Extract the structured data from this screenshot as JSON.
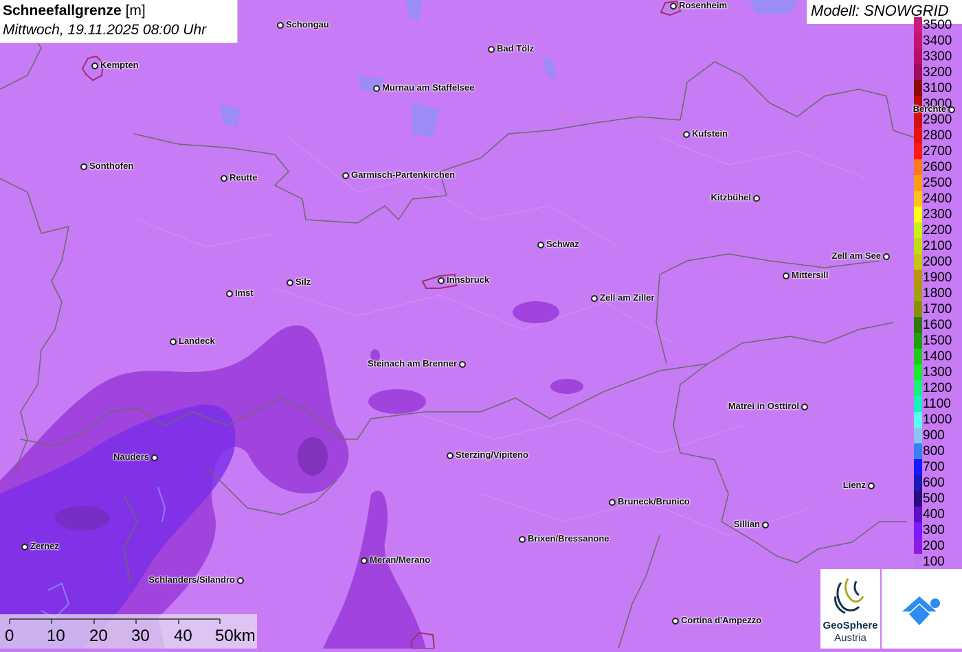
{
  "header": {
    "title": "Schneefallgrenze",
    "unit": "[m]",
    "datetime": "Mittwoch, 19.11.2025 08:00 Uhr"
  },
  "model": {
    "label": "Modell: SNOWGRID"
  },
  "legend": {
    "items": [
      {
        "value": "3500",
        "color": "#cc1a7a"
      },
      {
        "value": "3400",
        "color": "#c21572"
      },
      {
        "value": "3300",
        "color": "#b3106a"
      },
      {
        "value": "3200",
        "color": "#a10a5e"
      },
      {
        "value": "3100",
        "color": "#8e0a0a"
      },
      {
        "value": "3000",
        "color": "#b80c0c"
      },
      {
        "value": "2900",
        "color": "#d40f0f"
      },
      {
        "value": "2800",
        "color": "#e81313"
      },
      {
        "value": "2700",
        "color": "#ff1a1a"
      },
      {
        "value": "2600",
        "color": "#ff7a1a"
      },
      {
        "value": "2500",
        "color": "#ff9d1a"
      },
      {
        "value": "2400",
        "color": "#ffc21a"
      },
      {
        "value": "2300",
        "color": "#ffff1a"
      },
      {
        "value": "2200",
        "color": "#c8f01a"
      },
      {
        "value": "2100",
        "color": "#c0dc14"
      },
      {
        "value": "2000",
        "color": "#c8c314"
      },
      {
        "value": "1900",
        "color": "#b8960f"
      },
      {
        "value": "1800",
        "color": "#a3a00f"
      },
      {
        "value": "1700",
        "color": "#8a8f0a"
      },
      {
        "value": "1600",
        "color": "#2e7a10"
      },
      {
        "value": "1500",
        "color": "#1ea010"
      },
      {
        "value": "1400",
        "color": "#1ecb1a"
      },
      {
        "value": "1300",
        "color": "#1aea30"
      },
      {
        "value": "1200",
        "color": "#1af080"
      },
      {
        "value": "1100",
        "color": "#1af0c0"
      },
      {
        "value": "1000",
        "color": "#5cfff0"
      },
      {
        "value": "900",
        "color": "#8ec4f5"
      },
      {
        "value": "800",
        "color": "#3a80f0"
      },
      {
        "value": "700",
        "color": "#1a1aff"
      },
      {
        "value": "600",
        "color": "#1a1ab8"
      },
      {
        "value": "500",
        "color": "#2a0a80"
      },
      {
        "value": "400",
        "color": "#5c10c8"
      },
      {
        "value": "300",
        "color": "#7a1aff"
      },
      {
        "value": "200",
        "color": "#8e1ae6"
      },
      {
        "value": "100",
        "color": "#c07af0"
      }
    ]
  },
  "cities": [
    {
      "name": "Rosenheim",
      "side": "right"
    },
    {
      "name": "Schongau",
      "side": "right"
    },
    {
      "name": "Kempten",
      "side": "right"
    },
    {
      "name": "Bad Tölz",
      "side": "right"
    },
    {
      "name": "Murnau am Staffelsee",
      "side": "right"
    },
    {
      "name": "Berchte",
      "side": "left"
    },
    {
      "name": "Kufstein",
      "side": "right"
    },
    {
      "name": "Sonthofen",
      "side": "right"
    },
    {
      "name": "Reutte",
      "side": "right"
    },
    {
      "name": "Garmisch-Partenkirchen",
      "side": "right"
    },
    {
      "name": "Kitzbühel",
      "side": "left"
    },
    {
      "name": "Schwaz",
      "side": "right"
    },
    {
      "name": "Zell am See",
      "side": "left"
    },
    {
      "name": "Mittersill",
      "side": "right"
    },
    {
      "name": "Imst",
      "side": "right"
    },
    {
      "name": "Silz",
      "side": "right"
    },
    {
      "name": "Innsbruck",
      "side": "right"
    },
    {
      "name": "Zell am Ziller",
      "side": "right"
    },
    {
      "name": "Landeck",
      "side": "right"
    },
    {
      "name": "Steinach am Brenner",
      "side": "left"
    },
    {
      "name": "Matrei in Osttirol",
      "side": "left"
    },
    {
      "name": "Nauders",
      "side": "left"
    },
    {
      "name": "Sterzing/Vipiteno",
      "side": "right"
    },
    {
      "name": "Lienz",
      "side": "left"
    },
    {
      "name": "Bruneck/Brunico",
      "side": "right"
    },
    {
      "name": "Sillian",
      "side": "left"
    },
    {
      "name": "Brixen/Bressanone",
      "side": "right"
    },
    {
      "name": "Zernez",
      "side": "right"
    },
    {
      "name": "Meran/Merano",
      "side": "right"
    },
    {
      "name": "Schlanders/Silandro",
      "side": "left"
    },
    {
      "name": "Cortina d'Ampezzo",
      "side": "right"
    }
  ],
  "scale": {
    "labels": [
      "0",
      "10",
      "20",
      "30",
      "40",
      "50km"
    ]
  },
  "logos": {
    "geosphere_line1": "GeoSphere",
    "geosphere_line2": "Austria",
    "geosphere_icon": "geosphere-logo",
    "app_icon": "app-logo"
  },
  "colors": {
    "background": "#c77bf5",
    "low_zone": "#9a3ad8",
    "lowest_zone": "#7a2ee8",
    "border": "#6a6a6a"
  }
}
